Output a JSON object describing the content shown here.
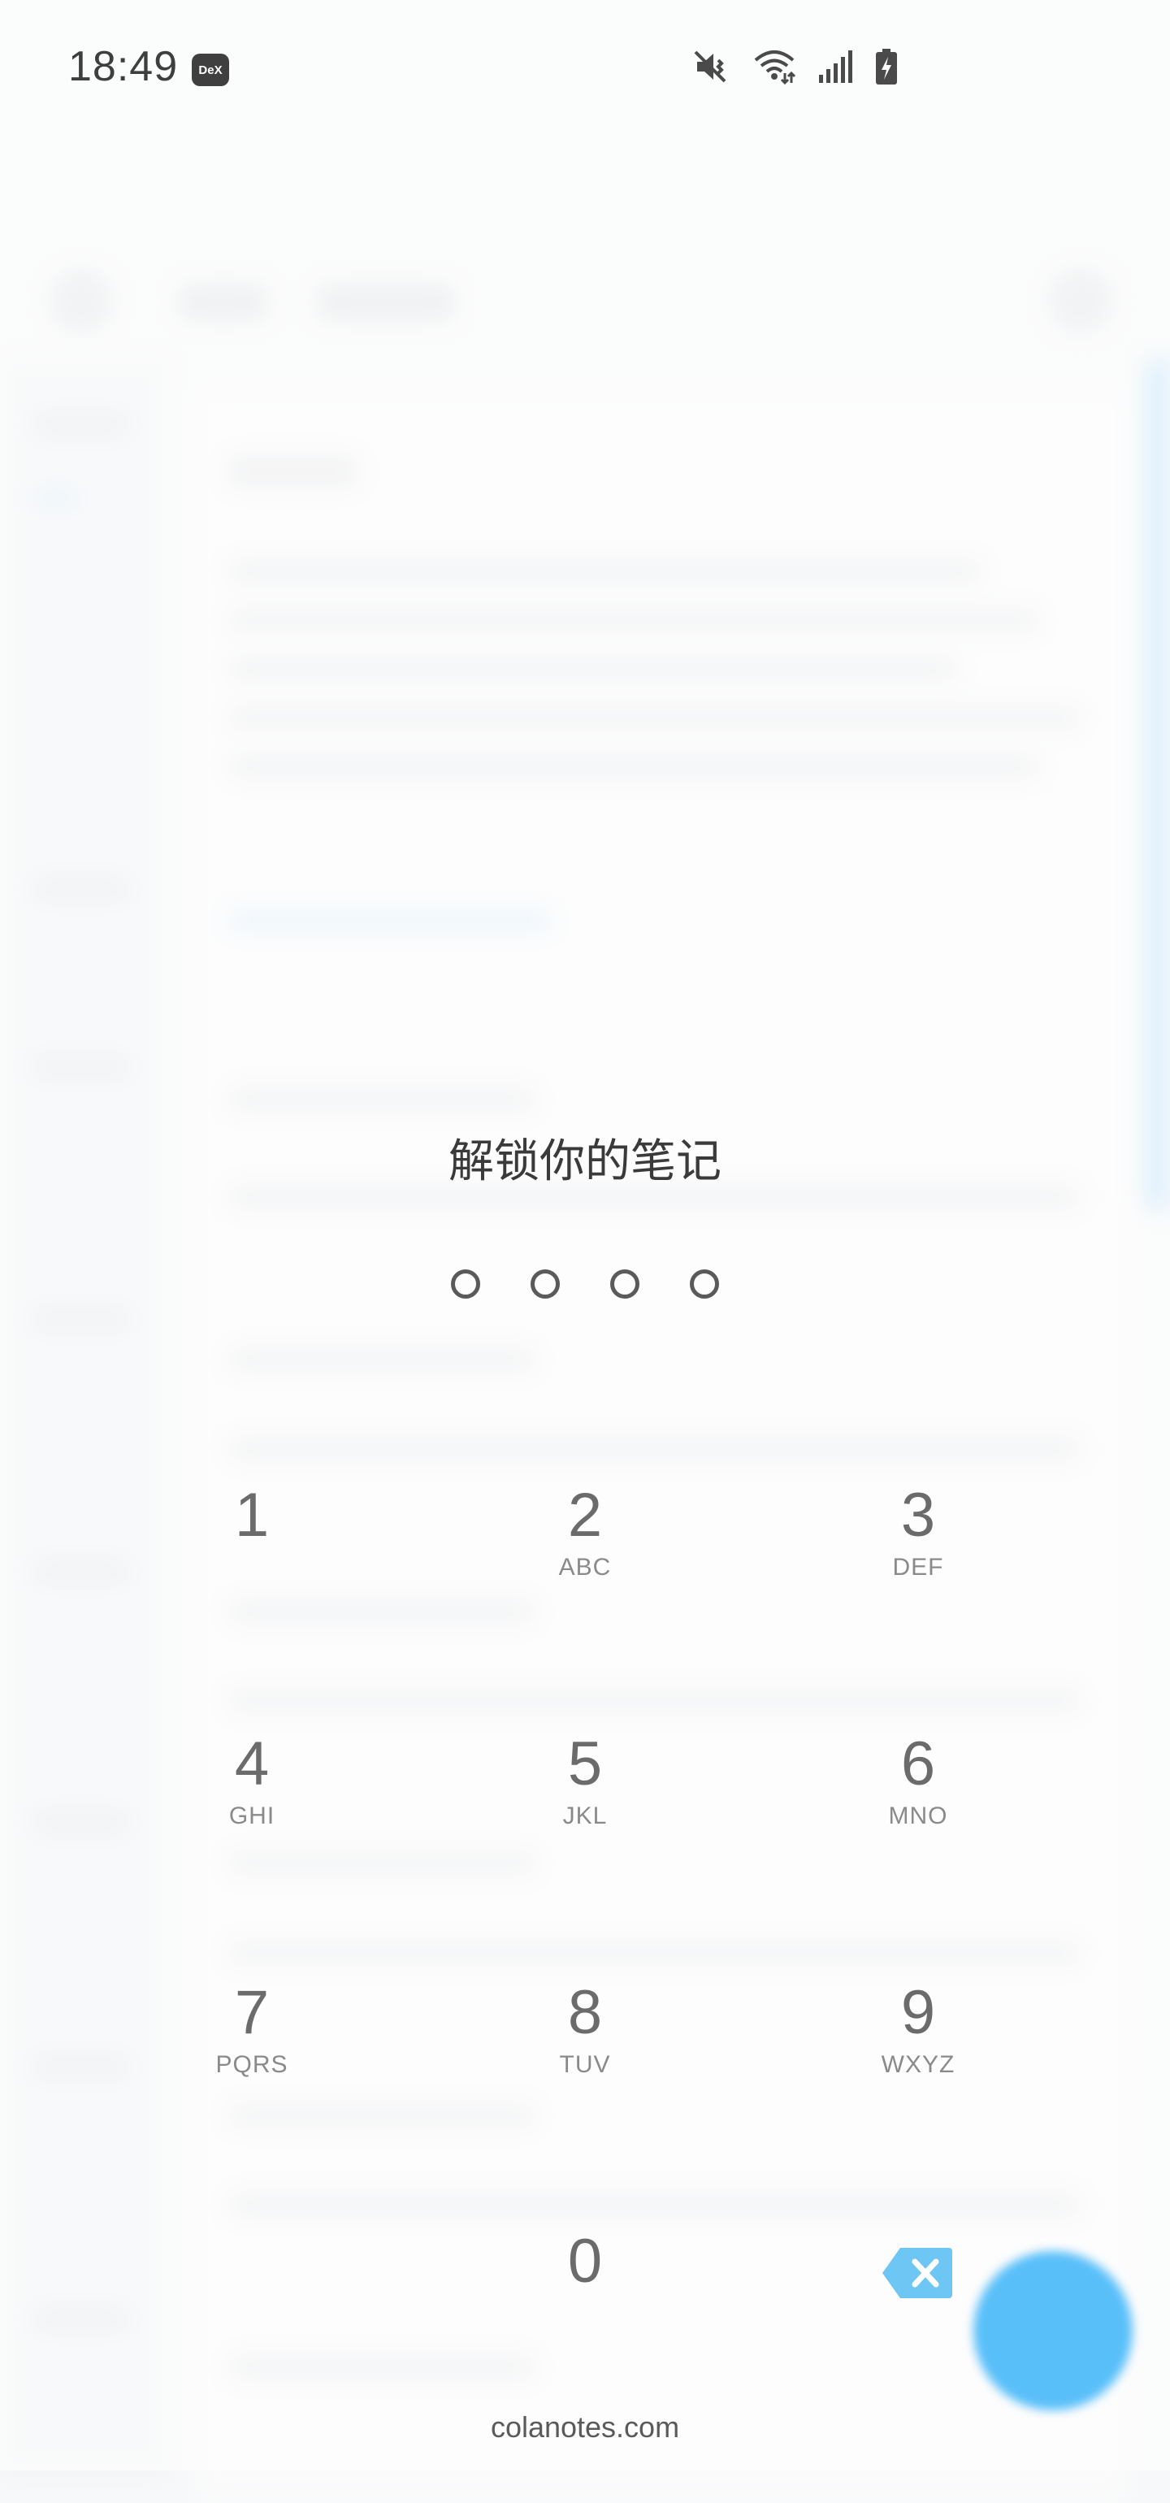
{
  "status_bar": {
    "time": "18:49",
    "dex_badge": "DeX",
    "icons": [
      "mute-icon",
      "wifi-icon",
      "signal-icon",
      "battery-charging-icon"
    ]
  },
  "lock": {
    "title": "解锁你的笔记",
    "pin_length": 4
  },
  "keypad": {
    "keys": [
      {
        "digit": "1",
        "letters": ""
      },
      {
        "digit": "2",
        "letters": "ABC"
      },
      {
        "digit": "3",
        "letters": "DEF"
      },
      {
        "digit": "4",
        "letters": "GHI"
      },
      {
        "digit": "5",
        "letters": "JKL"
      },
      {
        "digit": "6",
        "letters": "MNO"
      },
      {
        "digit": "7",
        "letters": "PQRS"
      },
      {
        "digit": "8",
        "letters": "TUV"
      },
      {
        "digit": "9",
        "letters": "WXYZ"
      },
      {
        "digit": "0",
        "letters": ""
      }
    ],
    "backspace_icon": "backspace-icon"
  },
  "footer": {
    "text": "colanotes.com"
  },
  "colors": {
    "accent": "#59bff9",
    "backspace": "#6ec6f5"
  }
}
